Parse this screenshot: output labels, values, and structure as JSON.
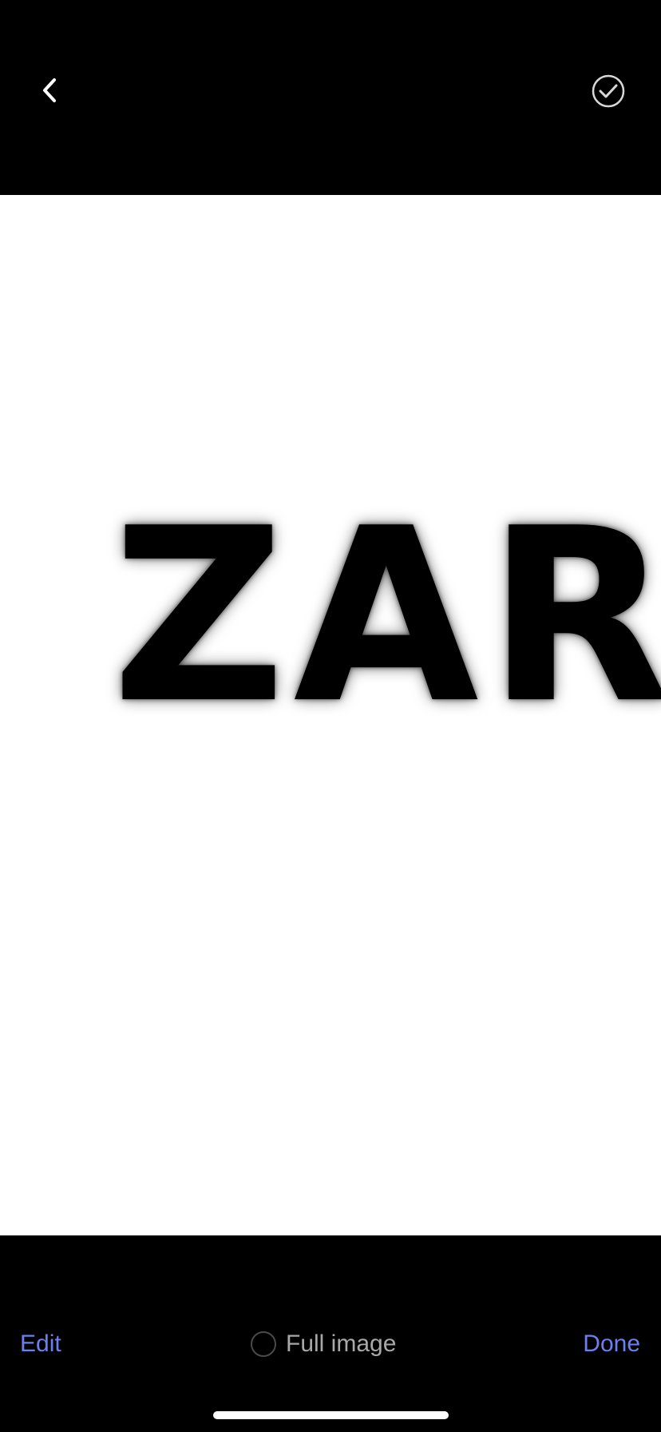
{
  "header": {
    "back_icon": "chevron-left-icon",
    "select_icon": "check-circle-icon"
  },
  "preview": {
    "text": "ZAR"
  },
  "footer": {
    "edit_label": "Edit",
    "full_image_label": "Full image",
    "full_image_selected": false,
    "done_label": "Done"
  },
  "colors": {
    "background": "#000000",
    "image_background": "#ffffff",
    "accent": "#6b7ff0",
    "secondary_text": "#a8a8a8"
  }
}
